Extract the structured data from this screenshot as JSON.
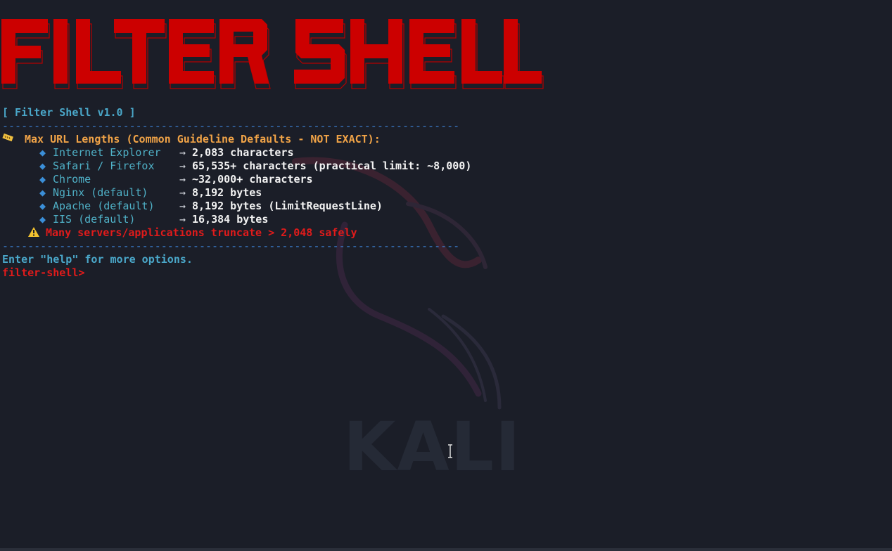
{
  "banner": {
    "title": "FILTER SHELL"
  },
  "header": {
    "version_line": "[ Filter Shell v1.0 ]"
  },
  "divider": "------------------------------------------------------------------------",
  "section": {
    "icon": "ruler-icon",
    "title": "Max URL Lengths (Common Guideline Defaults - NOT EXACT):"
  },
  "items": [
    {
      "label": "Internet Explorer",
      "value": "2,083 characters"
    },
    {
      "label": "Safari / Firefox",
      "value": "65,535+ characters (practical limit: ~8,000)"
    },
    {
      "label": "Chrome",
      "value": "~32,000+ characters"
    },
    {
      "label": "Nginx (default)",
      "value": "8,192 bytes"
    },
    {
      "label": "Apache (default)",
      "value": "8,192 bytes (LimitRequestLine)"
    },
    {
      "label": "IIS (default)",
      "value": "16,384 bytes"
    }
  ],
  "bullet": "◆",
  "arrow": "→",
  "warning": {
    "icon": "warning-icon",
    "text": "Many servers/applications truncate > 2,048 safely"
  },
  "help_line": "Enter \"help\" for more options.",
  "prompt": "filter-shell>",
  "watermark": "KALI",
  "colors": {
    "background": "#1b1e28",
    "banner_red": "#cc0000",
    "cyan": "#4aa7c9",
    "orange": "#f0a347",
    "red": "#e01b1b",
    "divider_blue": "#3b7fd0"
  }
}
